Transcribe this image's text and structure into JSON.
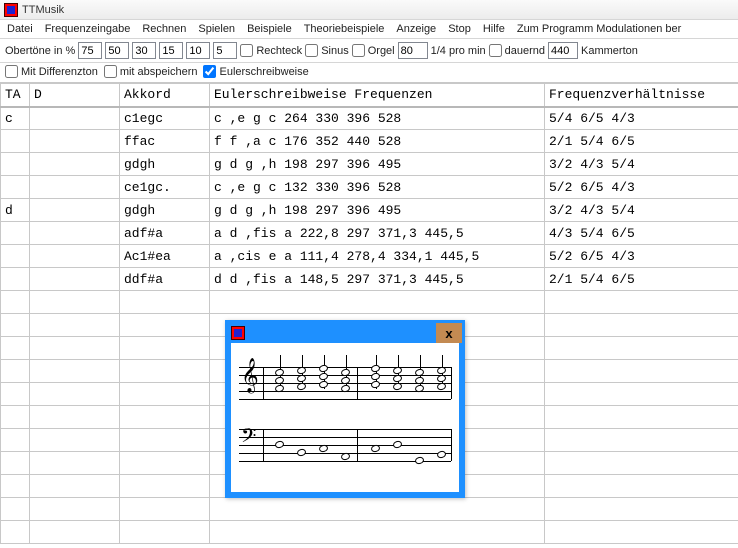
{
  "window": {
    "title": "TTMusik"
  },
  "menu": [
    "Datei",
    "Frequenzeingabe",
    "Rechnen",
    "Spielen",
    "Beispiele",
    "Theoriebeispiele",
    "Anzeige",
    "Stop",
    "Hilfe",
    "Zum Programm Modulationen ber"
  ],
  "toolbar": {
    "obertone_label": "Obertöne in %",
    "obertone": [
      "75",
      "50",
      "30",
      "15",
      "10",
      "5"
    ],
    "rechteck": "Rechteck",
    "sinus": "Sinus",
    "orgel": "Orgel",
    "bpm_val": "80",
    "bpm_label": "1/4 pro min",
    "dauernd": "dauernd",
    "kammer_val": "440",
    "kammer_label": "Kammerton"
  },
  "toolbar2": {
    "differenz": "Mit Differenzton",
    "abspeichern": "mit abspeichern",
    "euler": "Eulerschreibweise"
  },
  "headers": {
    "ta": "TA",
    "d": "D",
    "akkord": "Akkord",
    "euler": "Eulerschreibweise   Frequenzen",
    "fv": "Frequenzverhältnisse"
  },
  "rows": [
    {
      "ta": "c",
      "d": "",
      "ak": "c1egc",
      "eu": "c  ,e  g  c   264 330 396 528",
      "fv": "5/4 6/5 4/3"
    },
    {
      "ta": "",
      "d": "",
      "ak": "ffac",
      "eu": "f  f  ,a  c   176 352 440 528",
      "fv": "2/1 5/4 6/5"
    },
    {
      "ta": "",
      "d": "",
      "ak": "gdgh",
      "eu": "g  d  g  ,h   198 297 396 495",
      "fv": "3/2 4/3 5/4"
    },
    {
      "ta": "",
      "d": "",
      "ak": "ce1gc.",
      "eu": "c  ,e  g  c   132 330 396 528",
      "fv": "5/2 6/5 4/3"
    },
    {
      "ta": "d",
      "d": "",
      "ak": "gdgh",
      "eu": "g  d  g  ,h   198 297 396 495",
      "fv": "3/2 4/3 5/4"
    },
    {
      "ta": "",
      "d": "",
      "ak": "adf#a",
      "eu": "a  d  ,fis  a 222,8 297 371,3 445,5",
      "fv": "4/3 5/4 6/5"
    },
    {
      "ta": "",
      "d": "",
      "ak": "Ac1#ea",
      "eu": "a  ,cis  e  a 111,4 278,4 334,1 445,5",
      "fv": "5/2 6/5 4/3"
    },
    {
      "ta": "",
      "d": "",
      "ak": "ddf#a",
      "eu": "d  d  ,fis  a 148,5 297 371,3 445,5",
      "fv": "2/1 5/4 6/5"
    }
  ],
  "popup": {
    "close": "x"
  }
}
